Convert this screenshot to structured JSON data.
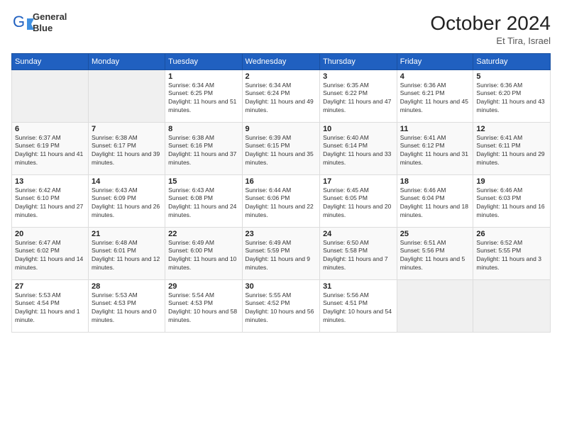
{
  "header": {
    "logo_line1": "General",
    "logo_line2": "Blue",
    "month_title": "October 2024",
    "location": "Et Tira, Israel"
  },
  "days_of_week": [
    "Sunday",
    "Monday",
    "Tuesday",
    "Wednesday",
    "Thursday",
    "Friday",
    "Saturday"
  ],
  "weeks": [
    [
      {
        "num": "",
        "sunrise": "",
        "sunset": "",
        "daylight": "",
        "empty": true
      },
      {
        "num": "",
        "sunrise": "",
        "sunset": "",
        "daylight": "",
        "empty": true
      },
      {
        "num": "1",
        "sunrise": "Sunrise: 6:34 AM",
        "sunset": "Sunset: 6:25 PM",
        "daylight": "Daylight: 11 hours and 51 minutes.",
        "empty": false
      },
      {
        "num": "2",
        "sunrise": "Sunrise: 6:34 AM",
        "sunset": "Sunset: 6:24 PM",
        "daylight": "Daylight: 11 hours and 49 minutes.",
        "empty": false
      },
      {
        "num": "3",
        "sunrise": "Sunrise: 6:35 AM",
        "sunset": "Sunset: 6:22 PM",
        "daylight": "Daylight: 11 hours and 47 minutes.",
        "empty": false
      },
      {
        "num": "4",
        "sunrise": "Sunrise: 6:36 AM",
        "sunset": "Sunset: 6:21 PM",
        "daylight": "Daylight: 11 hours and 45 minutes.",
        "empty": false
      },
      {
        "num": "5",
        "sunrise": "Sunrise: 6:36 AM",
        "sunset": "Sunset: 6:20 PM",
        "daylight": "Daylight: 11 hours and 43 minutes.",
        "empty": false
      }
    ],
    [
      {
        "num": "6",
        "sunrise": "Sunrise: 6:37 AM",
        "sunset": "Sunset: 6:19 PM",
        "daylight": "Daylight: 11 hours and 41 minutes.",
        "empty": false
      },
      {
        "num": "7",
        "sunrise": "Sunrise: 6:38 AM",
        "sunset": "Sunset: 6:17 PM",
        "daylight": "Daylight: 11 hours and 39 minutes.",
        "empty": false
      },
      {
        "num": "8",
        "sunrise": "Sunrise: 6:38 AM",
        "sunset": "Sunset: 6:16 PM",
        "daylight": "Daylight: 11 hours and 37 minutes.",
        "empty": false
      },
      {
        "num": "9",
        "sunrise": "Sunrise: 6:39 AM",
        "sunset": "Sunset: 6:15 PM",
        "daylight": "Daylight: 11 hours and 35 minutes.",
        "empty": false
      },
      {
        "num": "10",
        "sunrise": "Sunrise: 6:40 AM",
        "sunset": "Sunset: 6:14 PM",
        "daylight": "Daylight: 11 hours and 33 minutes.",
        "empty": false
      },
      {
        "num": "11",
        "sunrise": "Sunrise: 6:41 AM",
        "sunset": "Sunset: 6:12 PM",
        "daylight": "Daylight: 11 hours and 31 minutes.",
        "empty": false
      },
      {
        "num": "12",
        "sunrise": "Sunrise: 6:41 AM",
        "sunset": "Sunset: 6:11 PM",
        "daylight": "Daylight: 11 hours and 29 minutes.",
        "empty": false
      }
    ],
    [
      {
        "num": "13",
        "sunrise": "Sunrise: 6:42 AM",
        "sunset": "Sunset: 6:10 PM",
        "daylight": "Daylight: 11 hours and 27 minutes.",
        "empty": false
      },
      {
        "num": "14",
        "sunrise": "Sunrise: 6:43 AM",
        "sunset": "Sunset: 6:09 PM",
        "daylight": "Daylight: 11 hours and 26 minutes.",
        "empty": false
      },
      {
        "num": "15",
        "sunrise": "Sunrise: 6:43 AM",
        "sunset": "Sunset: 6:08 PM",
        "daylight": "Daylight: 11 hours and 24 minutes.",
        "empty": false
      },
      {
        "num": "16",
        "sunrise": "Sunrise: 6:44 AM",
        "sunset": "Sunset: 6:06 PM",
        "daylight": "Daylight: 11 hours and 22 minutes.",
        "empty": false
      },
      {
        "num": "17",
        "sunrise": "Sunrise: 6:45 AM",
        "sunset": "Sunset: 6:05 PM",
        "daylight": "Daylight: 11 hours and 20 minutes.",
        "empty": false
      },
      {
        "num": "18",
        "sunrise": "Sunrise: 6:46 AM",
        "sunset": "Sunset: 6:04 PM",
        "daylight": "Daylight: 11 hours and 18 minutes.",
        "empty": false
      },
      {
        "num": "19",
        "sunrise": "Sunrise: 6:46 AM",
        "sunset": "Sunset: 6:03 PM",
        "daylight": "Daylight: 11 hours and 16 minutes.",
        "empty": false
      }
    ],
    [
      {
        "num": "20",
        "sunrise": "Sunrise: 6:47 AM",
        "sunset": "Sunset: 6:02 PM",
        "daylight": "Daylight: 11 hours and 14 minutes.",
        "empty": false
      },
      {
        "num": "21",
        "sunrise": "Sunrise: 6:48 AM",
        "sunset": "Sunset: 6:01 PM",
        "daylight": "Daylight: 11 hours and 12 minutes.",
        "empty": false
      },
      {
        "num": "22",
        "sunrise": "Sunrise: 6:49 AM",
        "sunset": "Sunset: 6:00 PM",
        "daylight": "Daylight: 11 hours and 10 minutes.",
        "empty": false
      },
      {
        "num": "23",
        "sunrise": "Sunrise: 6:49 AM",
        "sunset": "Sunset: 5:59 PM",
        "daylight": "Daylight: 11 hours and 9 minutes.",
        "empty": false
      },
      {
        "num": "24",
        "sunrise": "Sunrise: 6:50 AM",
        "sunset": "Sunset: 5:58 PM",
        "daylight": "Daylight: 11 hours and 7 minutes.",
        "empty": false
      },
      {
        "num": "25",
        "sunrise": "Sunrise: 6:51 AM",
        "sunset": "Sunset: 5:56 PM",
        "daylight": "Daylight: 11 hours and 5 minutes.",
        "empty": false
      },
      {
        "num": "26",
        "sunrise": "Sunrise: 6:52 AM",
        "sunset": "Sunset: 5:55 PM",
        "daylight": "Daylight: 11 hours and 3 minutes.",
        "empty": false
      }
    ],
    [
      {
        "num": "27",
        "sunrise": "Sunrise: 5:53 AM",
        "sunset": "Sunset: 4:54 PM",
        "daylight": "Daylight: 11 hours and 1 minute.",
        "empty": false
      },
      {
        "num": "28",
        "sunrise": "Sunrise: 5:53 AM",
        "sunset": "Sunset: 4:53 PM",
        "daylight": "Daylight: 11 hours and 0 minutes.",
        "empty": false
      },
      {
        "num": "29",
        "sunrise": "Sunrise: 5:54 AM",
        "sunset": "Sunset: 4:53 PM",
        "daylight": "Daylight: 10 hours and 58 minutes.",
        "empty": false
      },
      {
        "num": "30",
        "sunrise": "Sunrise: 5:55 AM",
        "sunset": "Sunset: 4:52 PM",
        "daylight": "Daylight: 10 hours and 56 minutes.",
        "empty": false
      },
      {
        "num": "31",
        "sunrise": "Sunrise: 5:56 AM",
        "sunset": "Sunset: 4:51 PM",
        "daylight": "Daylight: 10 hours and 54 minutes.",
        "empty": false
      },
      {
        "num": "",
        "sunrise": "",
        "sunset": "",
        "daylight": "",
        "empty": true
      },
      {
        "num": "",
        "sunrise": "",
        "sunset": "",
        "daylight": "",
        "empty": true
      }
    ]
  ]
}
